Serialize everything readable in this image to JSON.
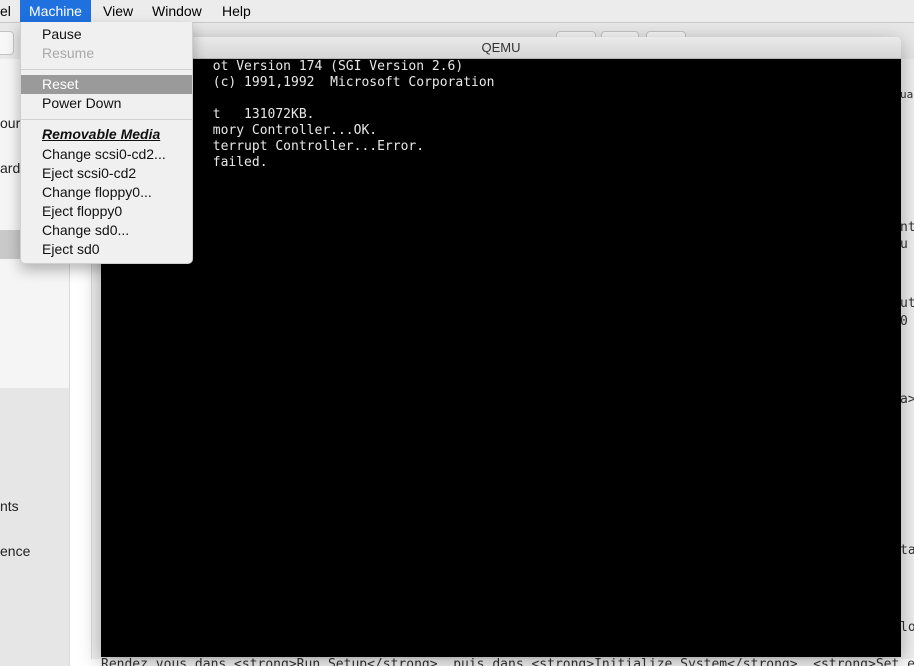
{
  "menubar": {
    "items": [
      {
        "label": "el"
      },
      {
        "label": "Machine"
      },
      {
        "label": "View"
      },
      {
        "label": "Window"
      },
      {
        "label": "Help"
      }
    ]
  },
  "machine_menu": {
    "pause": "Pause",
    "resume": "Resume",
    "reset": "Reset",
    "power_down": "Power Down",
    "removable_header": "Removable Media",
    "change_scsi": "Change scsi0-cd2...",
    "eject_scsi": "Eject scsi0-cd2",
    "change_floppy": "Change floppy0...",
    "eject_floppy": "Eject floppy0",
    "change_sd": "Change sd0...",
    "eject_sd": "Eject sd0"
  },
  "qemu": {
    "title": "QEMU",
    "console_lines": [
      "             ot Version 174 (SGI Version 2.6)",
      "             (c) 1991,1992  Microsoft Corporation",
      "",
      "             t   131072KB.",
      "             mory Controller...OK.",
      "             terrupt Controller...Error.",
      "             failed."
    ]
  },
  "background": {
    "sidebar_fragments": [
      "our",
      "ard",
      "nts",
      "ence"
    ],
    "right_fragments": [
      "ua",
      "nt",
      "u",
      "ut",
      "0",
      "a>",
      "ta",
      "lo"
    ],
    "bottom_line": "Rendez vous dans <strong>Run Setup</strong>, puis dans <strong>Initialize System</strong>, <strong>Set e"
  }
}
